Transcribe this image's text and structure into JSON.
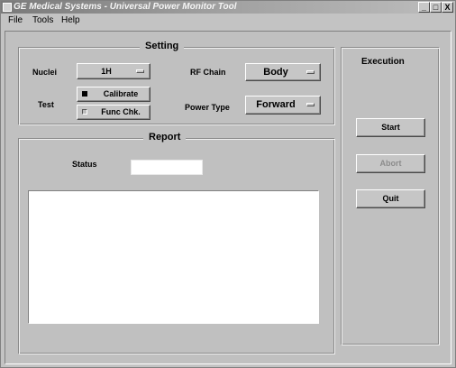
{
  "window": {
    "title": "GE Medical Systems - Universal Power Monitor Tool",
    "controls": {
      "minimize": "_",
      "maximize": "□",
      "close": "X"
    }
  },
  "menubar": {
    "items": [
      "File",
      "Tools",
      "Help"
    ]
  },
  "setting": {
    "title": "Setting",
    "nuclei_label": "Nuclei",
    "nuclei_value": "1H",
    "test_label": "Test",
    "test_options": [
      {
        "label": "Calibrate",
        "selected": true
      },
      {
        "label": "Func Chk.",
        "selected": false
      }
    ],
    "rf_chain_label": "RF Chain",
    "rf_chain_value": "Body",
    "power_type_label": "Power Type",
    "power_type_value": "Forward"
  },
  "report": {
    "title": "Report",
    "status_label": "Status",
    "status_value": "",
    "log_text": ""
  },
  "execution": {
    "title": "Execution",
    "start_label": "Start",
    "abort_label": "Abort",
    "abort_enabled": false,
    "quit_label": "Quit"
  },
  "colors": {
    "window_bg": "#c0c0c0",
    "titlebar_start": "#7a7a7a",
    "titlebar_end": "#bdbdbd",
    "disabled_text": "#8c8c8c"
  }
}
